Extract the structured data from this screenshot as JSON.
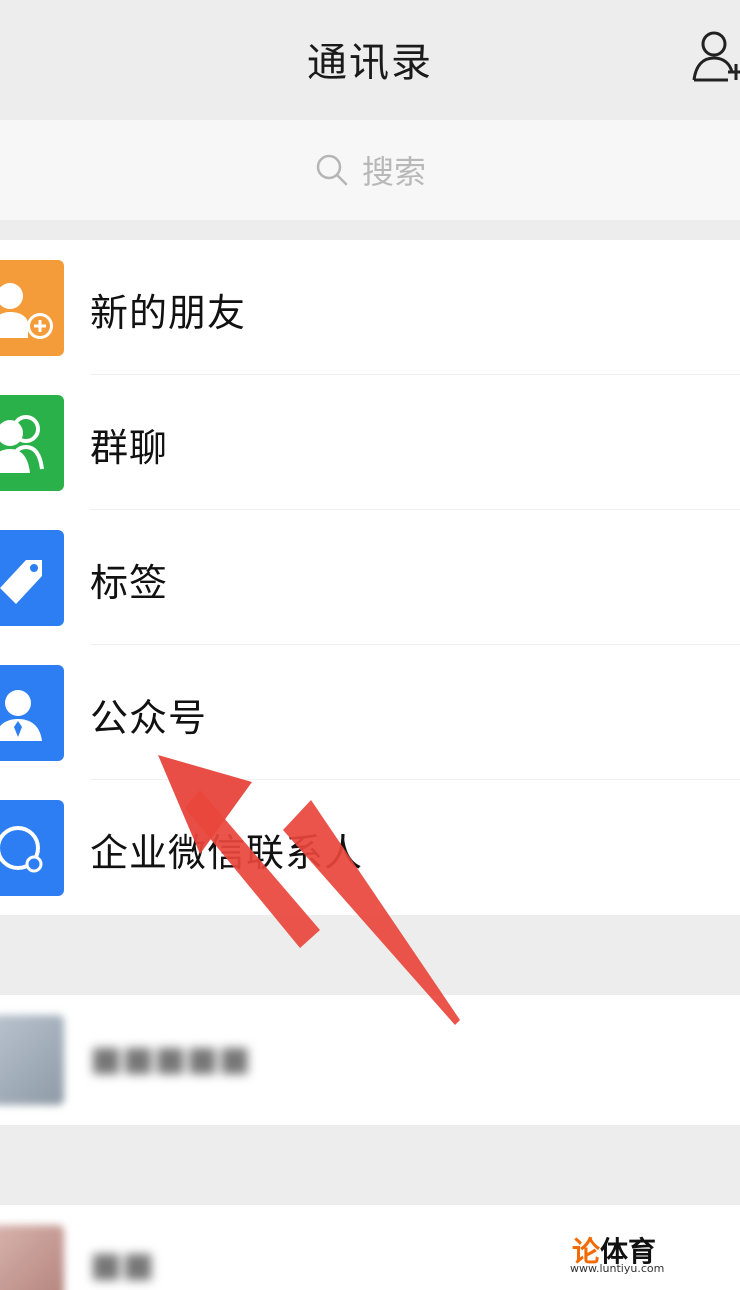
{
  "header": {
    "title": "通讯录",
    "add_icon": "add-friend-icon"
  },
  "search": {
    "placeholder": "搜索",
    "icon": "search-icon"
  },
  "menu": [
    {
      "label": "新的朋友",
      "icon": "new-friend-icon",
      "color": "#f59c3a"
    },
    {
      "label": "群聊",
      "icon": "group-chat-icon",
      "color": "#2bb14a"
    },
    {
      "label": "标签",
      "icon": "tag-icon",
      "color": "#2c7ef2"
    },
    {
      "label": "公众号",
      "icon": "official-account-icon",
      "color": "#2c7ef2"
    },
    {
      "label": "企业微信联系人",
      "icon": "wework-contacts-icon",
      "color": "#2c7ef2"
    }
  ],
  "annotation": {
    "arrow_color": "#e8453c",
    "points_to": "公众号"
  },
  "watermark": {
    "brand_accent": "论",
    "brand_rest": "体育",
    "url": "www.luntiyu.com"
  }
}
